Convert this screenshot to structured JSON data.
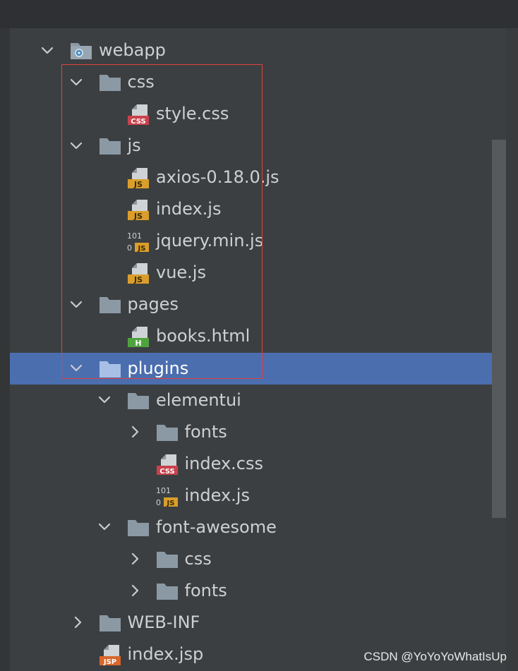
{
  "tree": [
    {
      "label": "webapp",
      "level": 0,
      "kind": "folder-web",
      "state": "expanded"
    },
    {
      "label": "css",
      "level": 1,
      "kind": "folder",
      "state": "expanded"
    },
    {
      "label": "style.css",
      "level": 2,
      "kind": "file-css",
      "badge": "CSS"
    },
    {
      "label": "js",
      "level": 1,
      "kind": "folder",
      "state": "expanded"
    },
    {
      "label": "axios-0.18.0.js",
      "level": 2,
      "kind": "file-js",
      "badge": "JS"
    },
    {
      "label": "index.js",
      "level": 2,
      "kind": "file-js",
      "badge": "JS"
    },
    {
      "label": "jquery.min.js",
      "level": 2,
      "kind": "file-js-min",
      "badge": "JS",
      "badge_top": "101"
    },
    {
      "label": "vue.js",
      "level": 2,
      "kind": "file-js",
      "badge": "JS"
    },
    {
      "label": "pages",
      "level": 1,
      "kind": "folder",
      "state": "expanded"
    },
    {
      "label": "books.html",
      "level": 2,
      "kind": "file-html",
      "badge": "H"
    },
    {
      "label": "plugins",
      "level": 1,
      "kind": "folder",
      "state": "expanded",
      "selected": true
    },
    {
      "label": "elementui",
      "level": 2,
      "kind": "folder",
      "state": "expanded"
    },
    {
      "label": "fonts",
      "level": 3,
      "kind": "folder",
      "state": "collapsed"
    },
    {
      "label": "index.css",
      "level": 3,
      "kind": "file-css",
      "badge": "CSS"
    },
    {
      "label": "index.js",
      "level": 3,
      "kind": "file-js-min",
      "badge": "JS",
      "badge_top": "101"
    },
    {
      "label": "font-awesome",
      "level": 2,
      "kind": "folder",
      "state": "expanded"
    },
    {
      "label": "css",
      "level": 3,
      "kind": "folder",
      "state": "collapsed"
    },
    {
      "label": "fonts",
      "level": 3,
      "kind": "folder",
      "state": "collapsed"
    },
    {
      "label": "WEB-INF",
      "level": 1,
      "kind": "folder",
      "state": "collapsed"
    },
    {
      "label": "index.jsp",
      "level": 1,
      "kind": "file-jsp",
      "badge": "JSP"
    }
  ],
  "watermark": "CSDN @YoYoYoWhatIsUp",
  "colors": {
    "background": "#3c3f41",
    "selection": "#4b6eaf",
    "text": "#cdd1d4",
    "folder": "#8b99a5",
    "css_badge": "#c9424e",
    "js_badge": "#d99e2b",
    "html_badge": "#4fa33f",
    "jsp_badge": "#d9662b",
    "highlight_box": "#e0423f"
  }
}
